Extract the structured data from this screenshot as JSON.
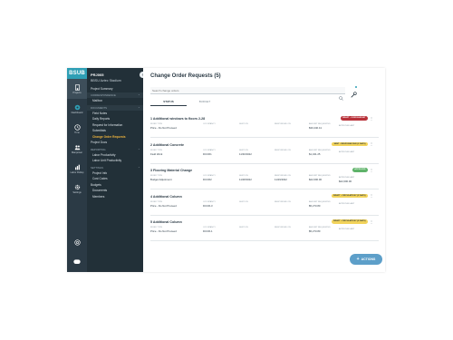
{
  "rail": {
    "logo": "BSUB",
    "items": [
      {
        "label": "Projects",
        "icon": "building-icon"
      },
      {
        "label": "Dashboard",
        "icon": "dashboard-icon"
      },
      {
        "label": "Time",
        "icon": "clock-icon"
      },
      {
        "label": "Manpower",
        "icon": "people-icon"
      },
      {
        "label": "Labor Rollup",
        "icon": "rollup-icon"
      },
      {
        "label": "Settings",
        "icon": "gear-icon"
      }
    ]
  },
  "sidebar": {
    "project_code": "PRJ005",
    "project_name": "BBSU Aztec Stadium",
    "items": [
      {
        "label": "Project Summary",
        "type": "top"
      },
      {
        "label": "CORRESPONDENCE",
        "type": "section",
        "boxed": true
      },
      {
        "label": "Mailbox",
        "type": "item"
      },
      {
        "label": "DOCUMENTS",
        "type": "section",
        "boxed": true
      },
      {
        "label": "Field Notes",
        "type": "item"
      },
      {
        "label": "Daily Reports",
        "type": "item"
      },
      {
        "label": "Request for Information",
        "type": "item"
      },
      {
        "label": "Submittals",
        "type": "item"
      },
      {
        "label": "Change Order Requests",
        "type": "item",
        "active": true
      },
      {
        "label": "Project Docs",
        "type": "top"
      },
      {
        "label": "REPORTING",
        "type": "section"
      },
      {
        "label": "Labor Productivity",
        "type": "item"
      },
      {
        "label": "Labor Unit Productivity",
        "type": "item"
      },
      {
        "label": "SETTINGS",
        "type": "section"
      },
      {
        "label": "Project Info",
        "type": "item"
      },
      {
        "label": "Cost Codes",
        "type": "item"
      },
      {
        "label": "Budgets",
        "type": "top"
      },
      {
        "label": "Documents",
        "type": "item"
      },
      {
        "label": "Members",
        "type": "item"
      }
    ]
  },
  "main": {
    "title": "Change Order Requests (5)",
    "search_placeholder": "Search change orders",
    "tabs": [
      {
        "label": "STATUS",
        "active": true
      },
      {
        "label": "BUDGET",
        "active": false
      }
    ],
    "field_labels": {
      "type": "WORK TYPE",
      "occ": "OCCUPANCY",
      "sent": "SENT ON",
      "resp": "RESPONDED ON",
      "amt": "AMOUNT REQUESTED",
      "appr": "APPROVED AMT"
    },
    "cards": [
      {
        "title": "1 Additional windows to floors 2-28",
        "type": "Price - Do Not Proceed",
        "occ": "",
        "sent": "",
        "resp": "",
        "amt": "$30,240.41",
        "appr": "",
        "status": "DRAFT - OVER BUDGET",
        "status_bg": "#b8323a",
        "status_fg": "#ffffff"
      },
      {
        "title": "2 Additional Concrete",
        "type": "Field Work",
        "occ": "DCCR1",
        "sent": "11/30/2022",
        "resp": "",
        "amt": "$1,341.25",
        "appr": "",
        "status": "SENT - RESPONSE DUE (2 DAYS)",
        "status_bg": "#f2d35a",
        "status_fg": "#2b3a45"
      },
      {
        "title": "3 Flooring Material Change",
        "type": "Budget Adjustment",
        "occ": "DCCR2",
        "sent": "11/28/2022",
        "resp": "11/29/2022",
        "amt": "$22,000.00",
        "appr": "$22,000.00",
        "status": "APPROVED",
        "status_bg": "#5fb36a",
        "status_fg": "#ffffff"
      },
      {
        "title": "4 Additional Column",
        "type": "Price - Do Not Proceed",
        "occ": "DCCR-3",
        "sent": "",
        "resp": "",
        "amt": "$5,273.80",
        "appr": "",
        "status": "DRAFT - CIRCULATE BY (X DAYS)",
        "status_bg": "#f2d35a",
        "status_fg": "#2b3a45"
      },
      {
        "title": "5 Additional Column",
        "type": "Price - Do Not Proceed",
        "occ": "DCCR-1",
        "sent": "",
        "resp": "",
        "amt": "$5,273.80",
        "appr": "",
        "status": "DRAFT - CIRCULATE BY (X DAYS)",
        "status_bg": "#f2d35a",
        "status_fg": "#2b3a45"
      }
    ],
    "actions_label": "ACTIONS"
  }
}
